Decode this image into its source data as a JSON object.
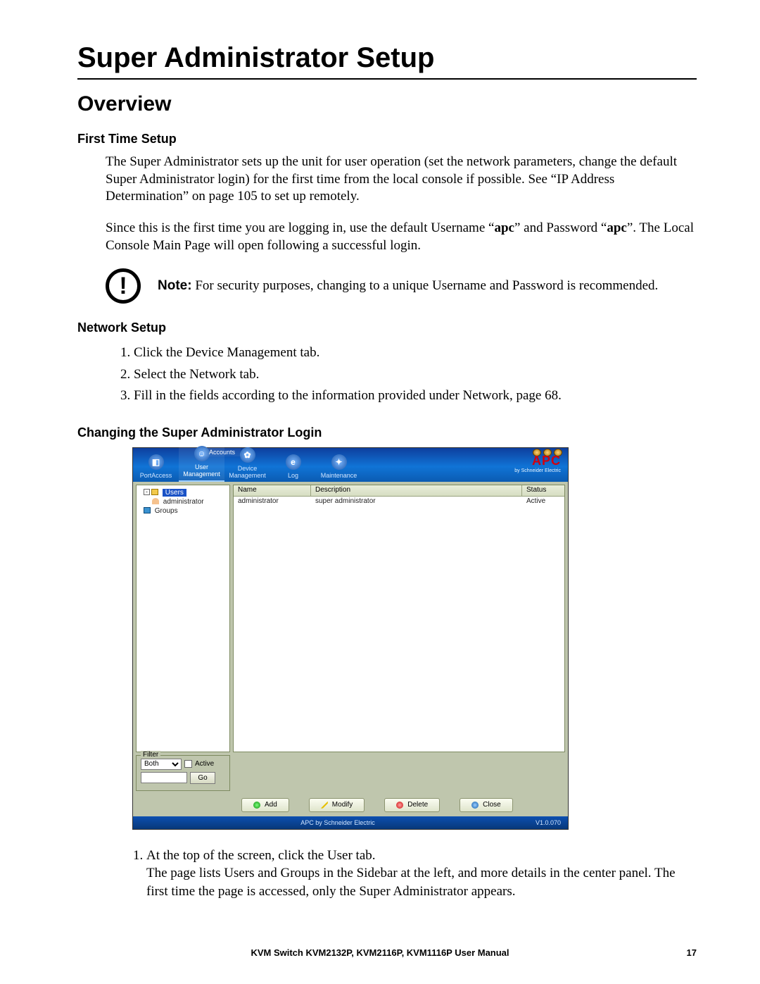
{
  "title": "Super Administrator Setup",
  "h2": "Overview",
  "sec1": {
    "heading": "First Time Setup",
    "p1": "The Super Administrator sets up the unit for user operation (set the network parameters, change the default Super Administrator login) for the first time from the local console if possible. See “IP Address Determination” on page 105 to set up remotely.",
    "p2_a": "Since this is the first time you are logging in, use the default Username “",
    "p2_b": "” and Password “",
    "p2_c": "”. The Local Console Main Page will open following a successful login.",
    "default_user": "apc",
    "default_pass": "apc"
  },
  "note": {
    "label": "Note:",
    "text": " For security purposes, changing to a unique Username and Password is recommended."
  },
  "sec2": {
    "heading": "Network Setup",
    "steps": [
      "Click the Device Management tab.",
      "Select the Network tab.",
      "Fill in the fields according to the information provided under Network, page 68."
    ]
  },
  "sec3": {
    "heading": "Changing the Super Administrator Login",
    "step1": "At the top of the screen, click the User tab.",
    "step1_detail": "The page lists Users and Groups in the Sidebar at the left, and more details in the center panel. The first time the page is accessed, only the Super Administrator appears."
  },
  "screenshot": {
    "tab_group_label": "Accounts",
    "tabs": {
      "port": "PortAccess",
      "user": "User Management",
      "device": "Device Management",
      "log": "Log",
      "maint": "Maintenance"
    },
    "logo_brand": "APC",
    "logo_sub": "by Schneider Electric",
    "tree": {
      "root": "Users",
      "admin": "administrator",
      "groups": "Groups"
    },
    "cols": {
      "name": "Name",
      "desc": "Description",
      "status": "Status"
    },
    "row": {
      "name": "administrator",
      "desc": "super administrator",
      "status": "Active"
    },
    "filter": {
      "title": "Filter",
      "select": "Both",
      "active": "Active",
      "go": "Go"
    },
    "actions": {
      "add": "Add",
      "modify": "Modify",
      "delete": "Delete",
      "close": "Close"
    },
    "status_center": "APC by Schneider Electric",
    "status_right": "V1.0.070"
  },
  "footer": {
    "title": "KVM Switch KVM2132P, KVM2116P, KVM1116P User Manual",
    "page": "17"
  }
}
